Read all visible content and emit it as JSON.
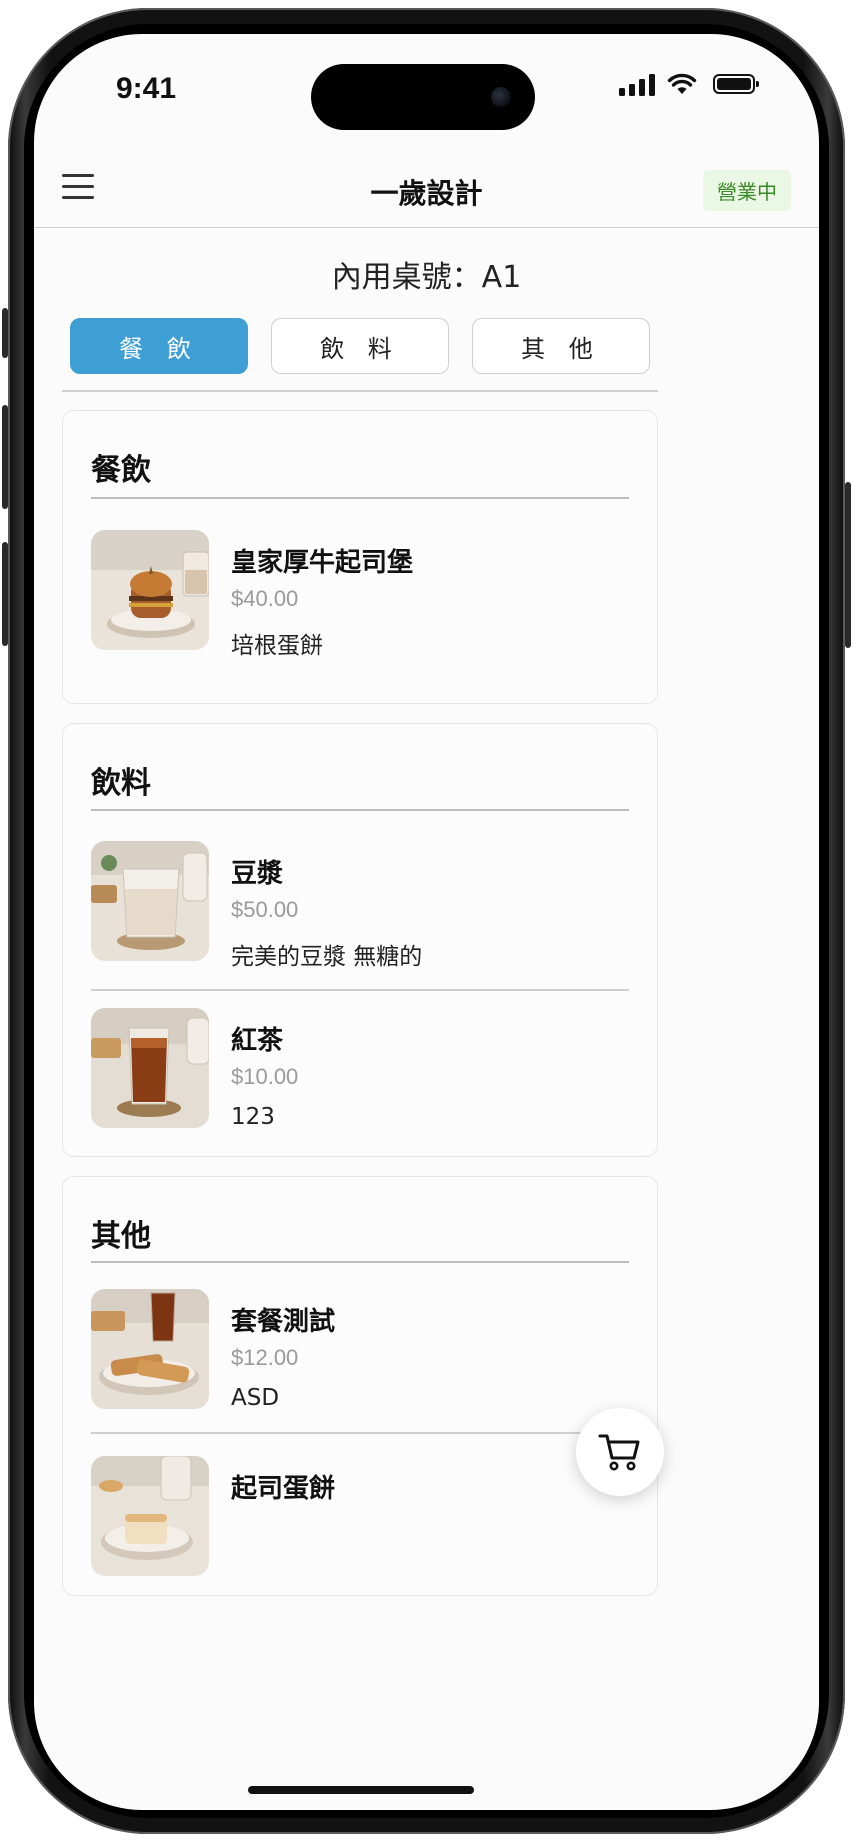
{
  "status_bar": {
    "time": "9:41"
  },
  "header": {
    "title": "一歲設計",
    "status_badge": "營業中"
  },
  "table_label": "內用桌號：A1",
  "tabs": [
    {
      "label": "餐 飲",
      "active": true
    },
    {
      "label": "飲 料",
      "active": false
    },
    {
      "label": "其 他",
      "active": false
    }
  ],
  "categories": [
    {
      "title": "餐飲",
      "items": [
        {
          "name": "皇家厚牛起司堡",
          "price": "$40.00",
          "description": "培根蛋餅",
          "image": "burger-photo"
        }
      ]
    },
    {
      "title": "飲料",
      "items": [
        {
          "name": "豆漿",
          "price": "$50.00",
          "description": "完美的豆漿 無糖的",
          "image": "soy-milk-photo"
        },
        {
          "name": "紅茶",
          "price": "$10.00",
          "description": "123",
          "image": "black-tea-photo"
        }
      ]
    },
    {
      "title": "其他",
      "items": [
        {
          "name": "套餐測試",
          "price": "$12.00",
          "description": "ASD",
          "image": "combo-meal-photo"
        },
        {
          "name": "起司蛋餅",
          "price": "",
          "description": "",
          "image": "cheese-egg-pancake-photo"
        }
      ]
    }
  ],
  "icons": {
    "menu": "hamburger-menu-icon",
    "cart": "shopping-cart-icon",
    "signal": "cellular-signal-icon",
    "wifi": "wifi-icon",
    "battery": "battery-icon"
  },
  "colors": {
    "accent": "#3d9fd3",
    "badge_bg": "#eaf7e4",
    "badge_text": "#3a8a2a",
    "price": "#9a9a9a"
  }
}
